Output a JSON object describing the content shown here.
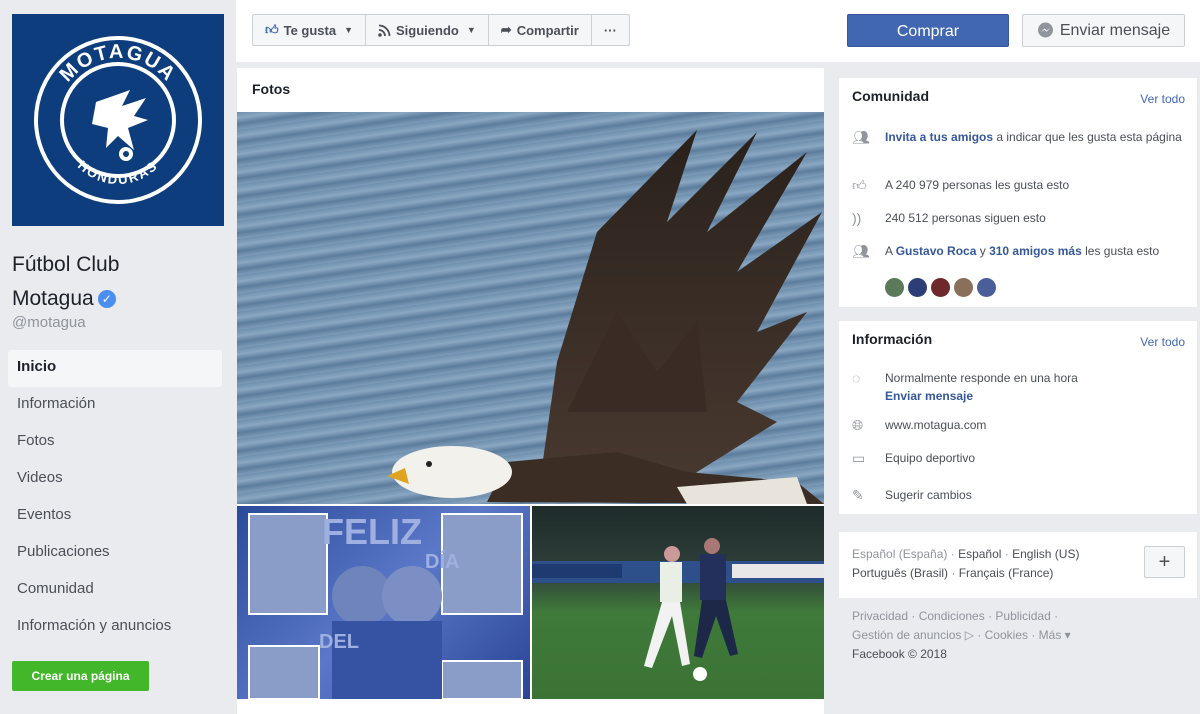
{
  "page": {
    "name_line1": "Fútbol Club",
    "name_line2": "Motagua",
    "handle": "@motagua",
    "logo_top_text": "MOTAGUA",
    "logo_bottom_text": "HONDURAS"
  },
  "nav": {
    "items": [
      {
        "label": "Inicio",
        "active": true
      },
      {
        "label": "Información"
      },
      {
        "label": "Fotos"
      },
      {
        "label": "Videos"
      },
      {
        "label": "Eventos"
      },
      {
        "label": "Publicaciones"
      },
      {
        "label": "Comunidad"
      },
      {
        "label": "Información y anuncios"
      }
    ],
    "create_page": "Crear una página"
  },
  "actions": {
    "like": "Te gusta",
    "following": "Siguiendo",
    "share": "Compartir",
    "more": "···",
    "buy": "Comprar",
    "message": "Enviar mensaje"
  },
  "photos": {
    "title": "Fotos",
    "banner_words": [
      "FELIZ",
      "DÍA",
      "DEL"
    ]
  },
  "community": {
    "title": "Comunidad",
    "see_all": "Ver todo",
    "invite_link": "Invita a tus amigos",
    "invite_rest": " a indicar que les gusta esta página",
    "likes": "A 240 979 personas les gusta esto",
    "follows": "240 512 personas siguen esto",
    "friends_prefix": "A ",
    "friend_name": "Gustavo Roca",
    "friends_mid": " y ",
    "friends_more": "310 amigos más",
    "friends_suffix": " les gusta esto"
  },
  "info": {
    "title": "Información",
    "see_all": "Ver todo",
    "response": "Normalmente responde en una hora",
    "send_message": "Enviar mensaje",
    "website": "www.motagua.com",
    "category": "Equipo deportivo",
    "suggest": "Sugerir cambios"
  },
  "languages": {
    "current": "Español (España)",
    "sep": " · ",
    "l1": "Español",
    "l2": "English (US)",
    "l3": "Português (Brasil)",
    "l4": "Français (France)"
  },
  "footer": {
    "line1": "Privacidad · Condiciones · Publicidad ·",
    "line2": "Gestión de anuncios ▷ · Cookies · Más ▾",
    "line3": "Facebook © 2018"
  },
  "colors": {
    "brand_blue": "#4267b2",
    "logo_bg": "#0d3d7c",
    "create_green": "#42b72a"
  }
}
